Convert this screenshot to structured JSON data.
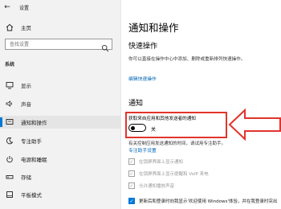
{
  "window": {
    "title": "设置"
  },
  "sidebar": {
    "home_label": "主页",
    "search": {
      "placeholder": "查找设置"
    },
    "section": "系统",
    "items": [
      {
        "label": "显示",
        "icon": "monitor-icon"
      },
      {
        "label": "声音",
        "icon": "speaker-icon"
      },
      {
        "label": "通知和操作",
        "icon": "notification-icon",
        "active": true
      },
      {
        "label": "专注助手",
        "icon": "moon-icon"
      },
      {
        "label": "电源和睡眠",
        "icon": "power-icon"
      },
      {
        "label": "存储",
        "icon": "storage-icon"
      },
      {
        "label": "平板模式",
        "icon": "tablet-icon"
      }
    ]
  },
  "main": {
    "title": "通知和操作",
    "quick_actions": {
      "heading": "快速操作",
      "description": "你可以直接在操作中心中添加、删除或重新排列快速操作。",
      "edit_link": "编辑快速操作"
    },
    "notifications": {
      "heading": "通知",
      "toggle_label": "获取来自应用和其他发送者的通知",
      "toggle_state": "关",
      "info_text": "有关控制应用发送通知的时间，请试用专注助手。",
      "focus_link": "专注助手设置",
      "checkboxes": [
        {
          "label": "在锁屏界面上显示通知",
          "checked": true,
          "enabled": false
        },
        {
          "label": "在锁屏界面上显示提醒和 VoIP 来电",
          "checked": true,
          "enabled": false
        },
        {
          "label": "允许通知播放声音",
          "checked": true,
          "enabled": false
        },
        {
          "label": "更新后和登录时向我显示'欢迎使用 Windows'体验，并在我登录时突出",
          "checked": true,
          "enabled": true
        }
      ]
    }
  },
  "colors": {
    "accent": "#0078d7",
    "highlight_box": "#e1352c"
  }
}
